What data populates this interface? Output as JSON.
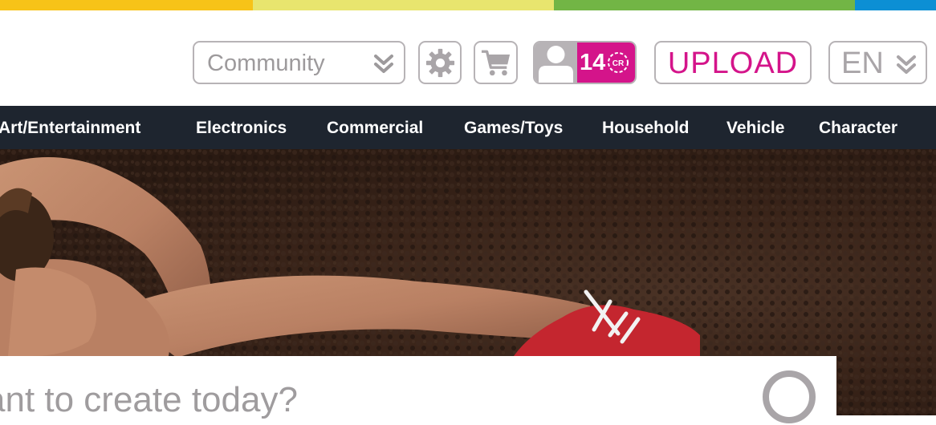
{
  "top_bar": {
    "colors": [
      "#f7c318",
      "#e8e56e",
      "#72b545",
      "#0c8fd4"
    ]
  },
  "header": {
    "community_select": {
      "value": "Community",
      "icon": "double-chevron-down-icon"
    },
    "settings_button": {
      "icon": "gear-icon"
    },
    "cart_button": {
      "icon": "cart-icon"
    },
    "profile": {
      "avatar_icon": "user-icon",
      "credits": "14",
      "credits_icon": "cr-coin-icon"
    },
    "upload_label": "UPLOAD",
    "language": {
      "value": "EN",
      "icon": "double-chevron-down-icon"
    }
  },
  "nav": {
    "items": [
      "Art/Entertainment",
      "Electronics",
      "Commercial",
      "Games/Toys",
      "Household",
      "Vehicle",
      "Character"
    ]
  },
  "hero": {
    "search_prompt": "ant to create today?",
    "spinner_icon": "loading-ring-icon"
  },
  "colors": {
    "accent": "#d4148a",
    "nav_bg": "#1e252f",
    "border": "#b7b3b6"
  }
}
